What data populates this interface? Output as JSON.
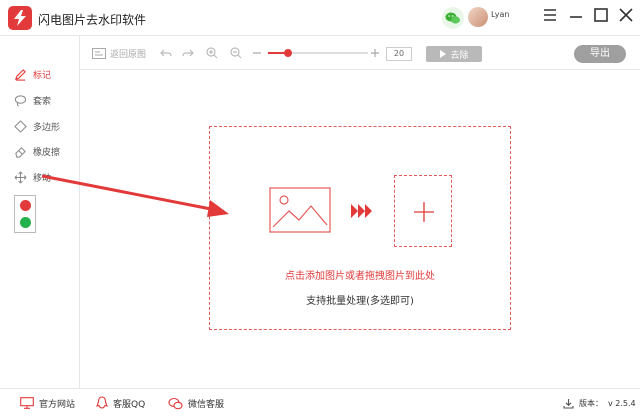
{
  "app": {
    "title": "闪电图片去水印软件",
    "username": "Lyan",
    "accent_color": "#e23a3a"
  },
  "window_controls": [
    "menu-icon",
    "minimize-icon",
    "maximize-icon",
    "close-icon"
  ],
  "sidebar": {
    "tools": [
      {
        "label": "标记",
        "icon": "pen-icon",
        "active": true
      },
      {
        "label": "套索",
        "icon": "lasso-icon",
        "active": false
      },
      {
        "label": "多边形",
        "icon": "polygon-icon",
        "active": false
      },
      {
        "label": "橡皮擦",
        "icon": "eraser-icon",
        "active": false
      },
      {
        "label": "移动",
        "icon": "move-icon",
        "active": false
      }
    ],
    "colors": [
      "#e23a3a",
      "#22b14c"
    ]
  },
  "toolbar": {
    "restore_label": "返回原图",
    "zoom_value": "20",
    "zoom_fraction": 0.2,
    "remove_label": "去除",
    "export_label": "导出"
  },
  "dropzone": {
    "title": "点击添加图片或者拖拽图片到此处",
    "subtitle": "支持批量处理(多选即可)"
  },
  "statusbar": {
    "website_label": "官方网站",
    "qq_label": "客服QQ",
    "wechat_label": "微信客服",
    "version_label": "版本：",
    "version_value": "v 2.5.4"
  }
}
